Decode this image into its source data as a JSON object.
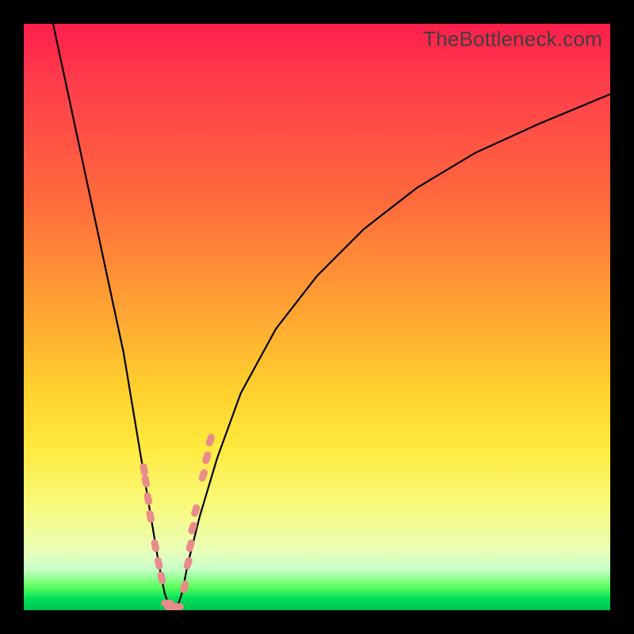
{
  "watermark": "TheBottleneck.com",
  "colors": {
    "frame": "#000000",
    "curve": "#000000",
    "marker": "#e98b8b",
    "gradient_top": "#ff1e4b",
    "gradient_bottom": "#00c24e"
  },
  "chart_data": {
    "type": "line",
    "title": "",
    "xlabel": "",
    "ylabel": "",
    "xlim": [
      0,
      100
    ],
    "ylim": [
      0,
      100
    ],
    "note": "V-shaped bottleneck curve on a red-to-green vertical gradient. y=0 (bottom, green) is optimal; y=100 (top, red) is worst. No axis ticks or numeric labels are rendered.",
    "series": [
      {
        "name": "bottleneck-curve",
        "x": [
          5,
          8,
          11,
          14,
          17,
          19,
          20,
          21,
          22,
          23,
          24,
          25,
          26,
          27,
          28,
          30,
          33,
          37,
          43,
          50,
          58,
          67,
          77,
          88,
          100
        ],
        "y": [
          100,
          86,
          72,
          58,
          44,
          32,
          26,
          20,
          14,
          8,
          3,
          0,
          0,
          3,
          8,
          16,
          26,
          37,
          48,
          57,
          65,
          72,
          78,
          83,
          88
        ]
      }
    ],
    "markers": {
      "name": "highlighted-points",
      "note": "Salmon capsule markers clustered near the valley of the curve.",
      "points": [
        {
          "x": 20.5,
          "y": 24
        },
        {
          "x": 20.8,
          "y": 22
        },
        {
          "x": 21.2,
          "y": 19
        },
        {
          "x": 21.6,
          "y": 16
        },
        {
          "x": 22.4,
          "y": 11
        },
        {
          "x": 23.0,
          "y": 8
        },
        {
          "x": 23.5,
          "y": 5.5
        },
        {
          "x": 24.5,
          "y": 1.2
        },
        {
          "x": 25.0,
          "y": 0.6
        },
        {
          "x": 25.6,
          "y": 0.6
        },
        {
          "x": 26.2,
          "y": 0.6
        },
        {
          "x": 27.4,
          "y": 4
        },
        {
          "x": 28.0,
          "y": 8
        },
        {
          "x": 28.4,
          "y": 11
        },
        {
          "x": 28.8,
          "y": 14
        },
        {
          "x": 29.3,
          "y": 17
        },
        {
          "x": 30.6,
          "y": 23
        },
        {
          "x": 31.2,
          "y": 26
        },
        {
          "x": 31.8,
          "y": 29
        }
      ]
    }
  }
}
